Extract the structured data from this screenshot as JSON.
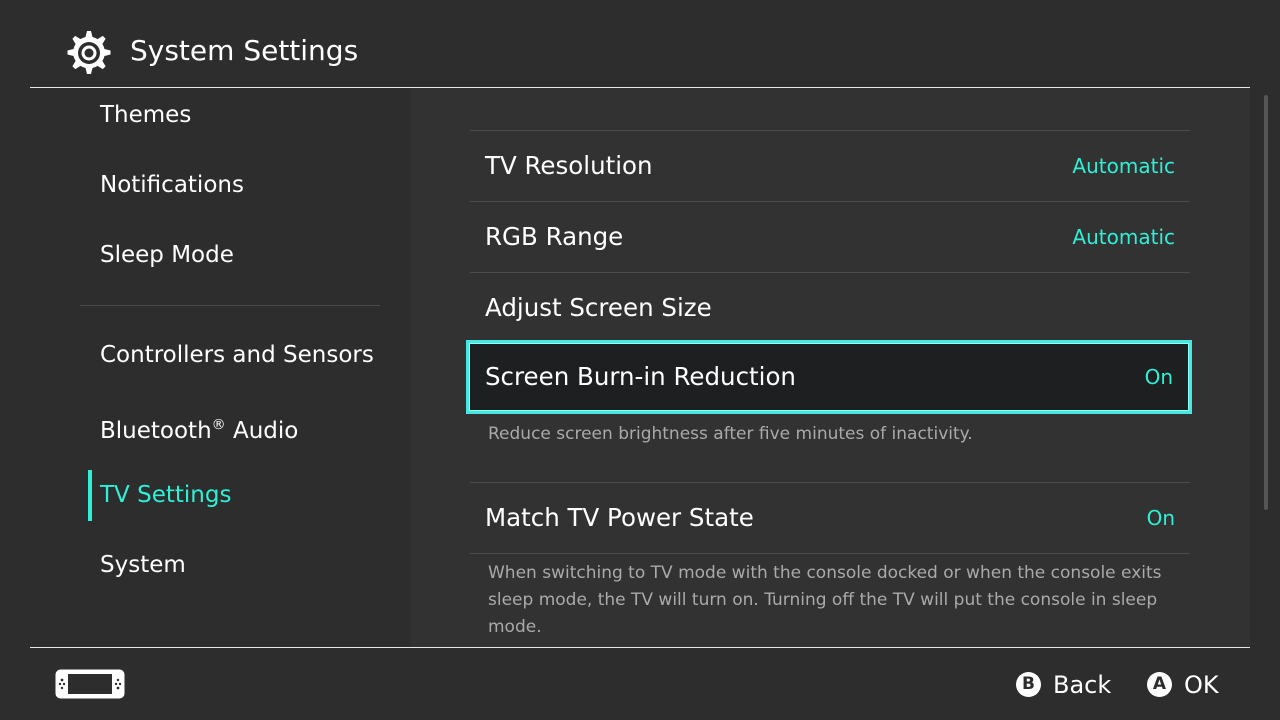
{
  "header": {
    "title": "System Settings",
    "icon": "gear-icon"
  },
  "sidebar": {
    "items": [
      {
        "label": "Themes"
      },
      {
        "label": "Notifications"
      },
      {
        "label": "Sleep Mode"
      },
      {
        "label": "Controllers and Sensors"
      },
      {
        "label": "Bluetooth",
        "sup": "®",
        "suffix": " Audio"
      },
      {
        "label": "TV Settings",
        "active": true
      },
      {
        "label": "System"
      }
    ]
  },
  "content": {
    "rows": [
      {
        "label": "TV Resolution",
        "value": "Automatic"
      },
      {
        "label": "RGB Range",
        "value": "Automatic"
      },
      {
        "label": "Adjust Screen Size",
        "value": ""
      },
      {
        "label": "Screen Burn-in Reduction",
        "value": "On",
        "selected": true,
        "description": "Reduce screen brightness after five minutes of inactivity."
      },
      {
        "label": "Match TV Power State",
        "value": "On",
        "description": "When switching to TV mode with the console docked or when the console exits sleep mode, the TV will turn on. Turning off the TV will put the console in sleep mode."
      }
    ]
  },
  "footer": {
    "console_icon": "console-icon",
    "back": {
      "button": "B",
      "label": "Back"
    },
    "ok": {
      "button": "A",
      "label": "OK"
    }
  },
  "colors": {
    "accent": "#2ff0d7",
    "background": "#2d2d2d",
    "selection_border": "#46e8e1"
  }
}
